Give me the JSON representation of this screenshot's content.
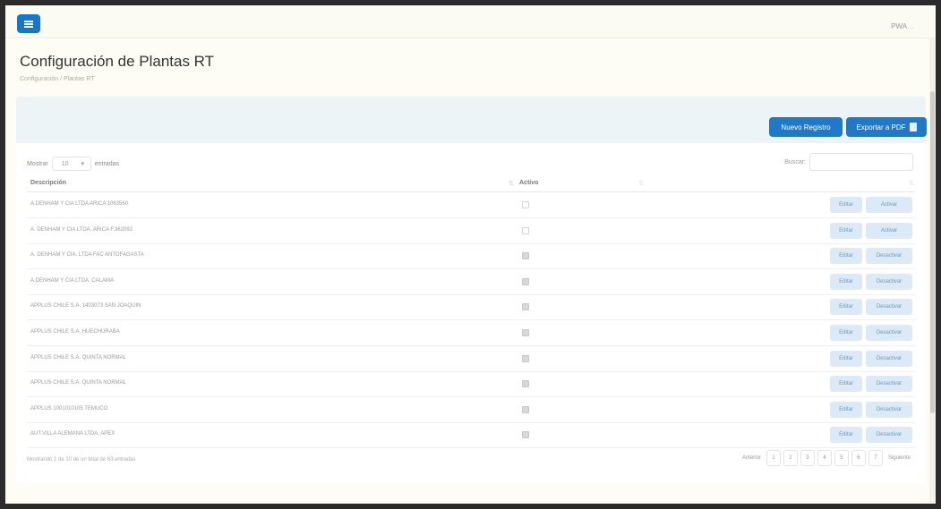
{
  "header": {
    "user_label": "PWA"
  },
  "page": {
    "title": "Configuración de Plantas RT",
    "breadcrumb": "Configuración / Plantas RT"
  },
  "toolbar": {
    "new_label": "Nuevo Registro",
    "pdf_label": "Exportar a PDF"
  },
  "table": {
    "length_prefix": "Mostrar",
    "length_value": "10",
    "length_suffix": "entradas",
    "search_label": "Buscar:",
    "search_value": "",
    "headers": {
      "description": "Descripción",
      "active": "Activo"
    },
    "rows": [
      {
        "description": "A.DENHAM Y CIA LTDA ARICA 1063560",
        "active": false,
        "edit": "Editar",
        "toggle": "Activar"
      },
      {
        "description": "A. DENHAM Y CIA LTDA. ARICA F.362092",
        "active": false,
        "edit": "Editar",
        "toggle": "Activar"
      },
      {
        "description": "A. DENHAM Y CIA. LTDA FAC ANTOFAGASTA",
        "active": true,
        "edit": "Editar",
        "toggle": "Desactivar"
      },
      {
        "description": "A.DENHAM Y CIA LTDA. CALAMA",
        "active": true,
        "edit": "Editar",
        "toggle": "Desactivar"
      },
      {
        "description": "APPLUS CHILE S.A. 1403073 SAN JOAQUIN",
        "active": true,
        "edit": "Editar",
        "toggle": "Desactivar"
      },
      {
        "description": "APPLUS CHILE S.A. HUECHURABA",
        "active": true,
        "edit": "Editar",
        "toggle": "Desactivar"
      },
      {
        "description": "APPLUS CHILE S.A. QUINTA NORMAL",
        "active": true,
        "edit": "Editar",
        "toggle": "Desactivar"
      },
      {
        "description": "APPLUS CHILE S.A. QUINTA NORMAL",
        "active": true,
        "edit": "Editar",
        "toggle": "Desactivar"
      },
      {
        "description": "APPLUS 1001010105 TEMUCO",
        "active": true,
        "edit": "Editar",
        "toggle": "Desactivar"
      },
      {
        "description": "AUT.VILLA ALEMANA LTDA. APEX",
        "active": true,
        "edit": "Editar",
        "toggle": "Desactivar"
      }
    ],
    "info": "Mostrando 1 de 10 de un total de 63 entradas",
    "pagination": {
      "prev": "Anterior",
      "pages": [
        "1",
        "2",
        "3",
        "4",
        "5",
        "6",
        "7"
      ],
      "next": "Siguiente"
    }
  }
}
